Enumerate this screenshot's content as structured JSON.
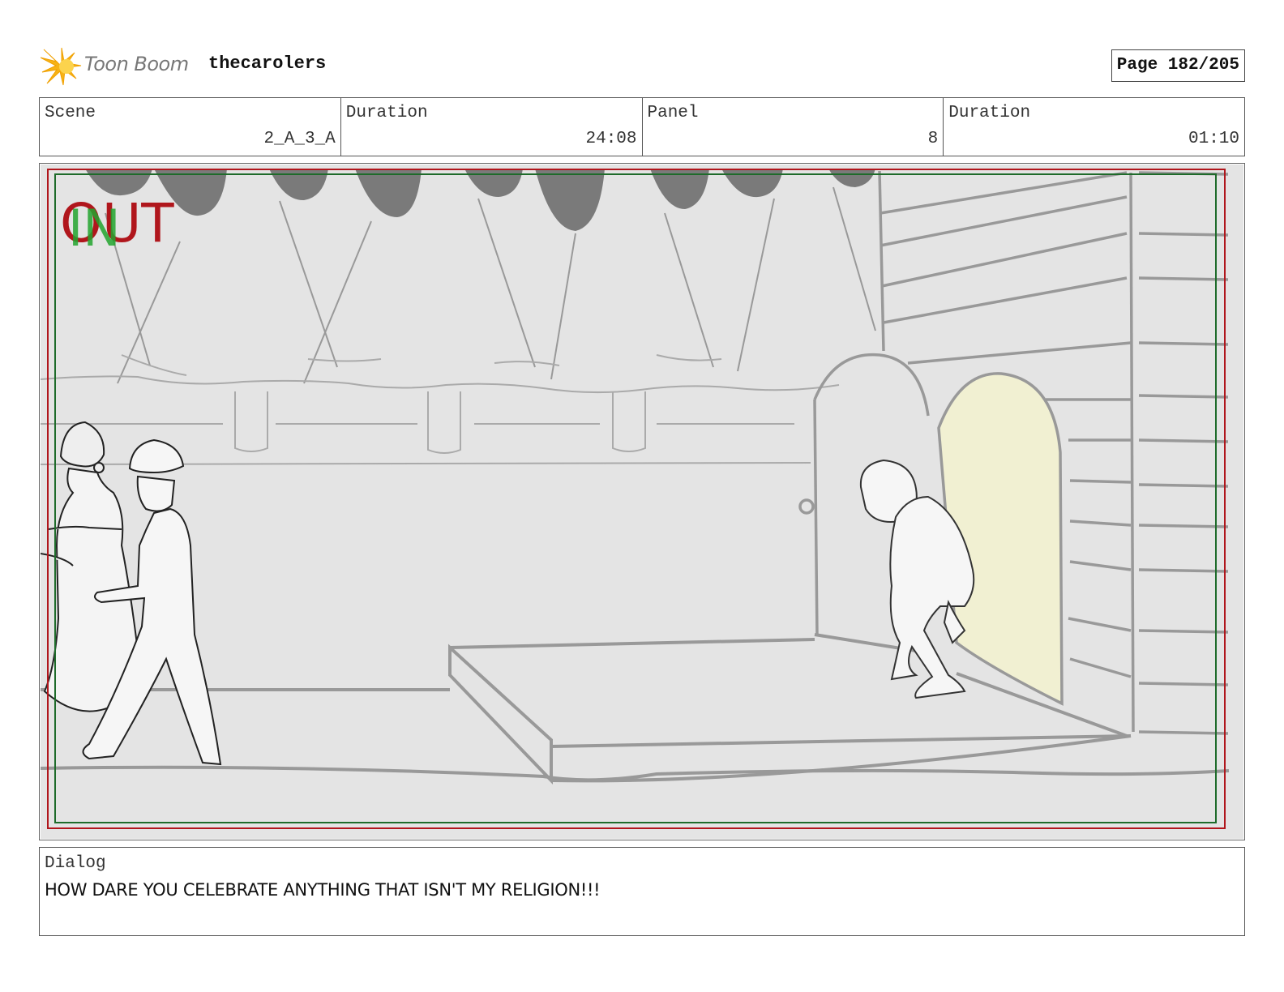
{
  "header": {
    "brand": "Toon Boom",
    "project": "thecarolers",
    "page": "Page 182/205"
  },
  "info": {
    "scene_label": "Scene",
    "scene_value": "2_A_3_A",
    "scene_duration_label": "Duration",
    "scene_duration_value": "24:08",
    "panel_label": "Panel",
    "panel_value": "8",
    "panel_duration_label": "Duration",
    "panel_duration_value": "01:10"
  },
  "panel": {
    "out_marker": "OUT",
    "in_marker": "IN",
    "out_color": "#b0161c",
    "in_color": "#22a52e",
    "door_light_color": "#f1f0d2",
    "background_color": "#e4e4e4"
  },
  "dialog": {
    "label": "Dialog",
    "text": "HOW DARE YOU CELEBRATE ANYTHING THAT ISN'T MY RELIGION!!!"
  }
}
